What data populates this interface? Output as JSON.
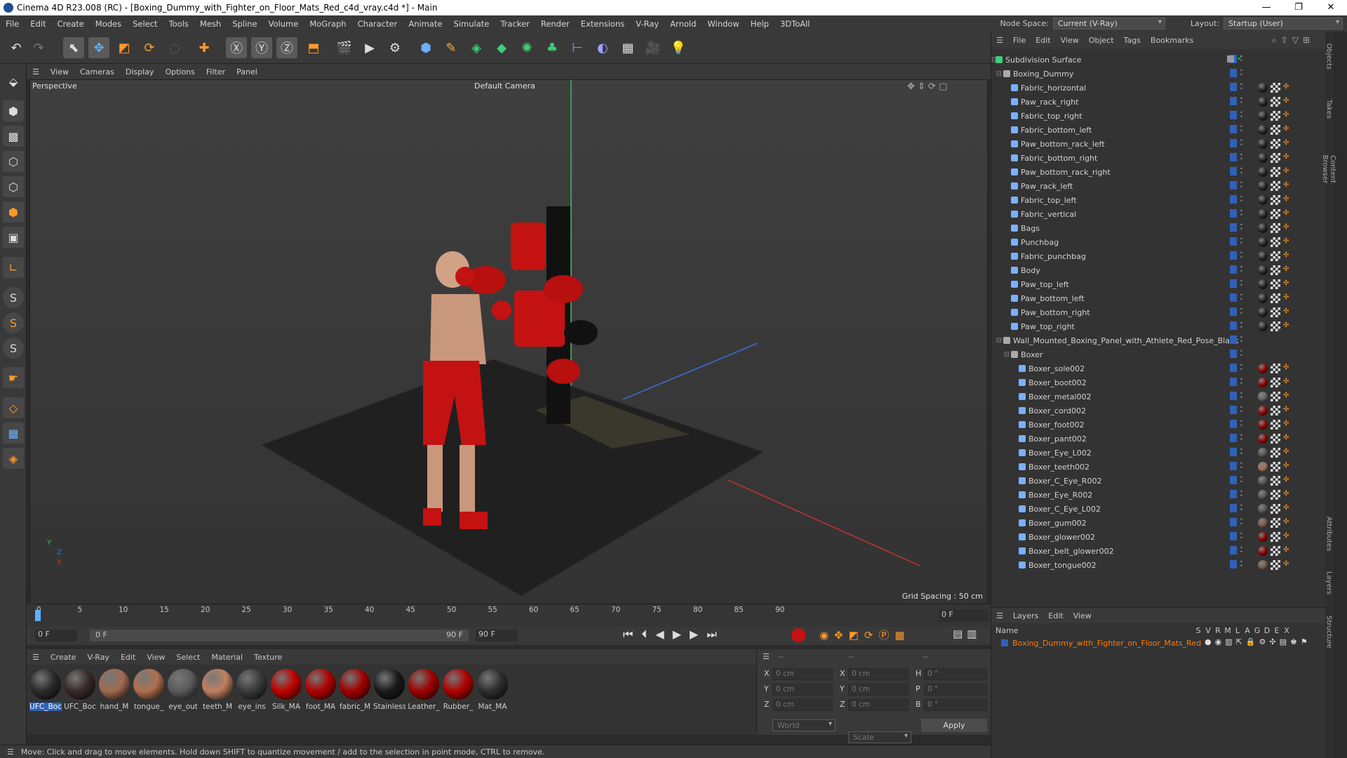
{
  "window": {
    "title": "Cinema 4D R23.008 (RC) - [Boxing_Dummy_with_Fighter_on_Floor_Mats_Red_c4d_vray.c4d *] - Main",
    "controls": [
      "—",
      "❐",
      "✕"
    ]
  },
  "menubar": {
    "items": [
      "File",
      "Edit",
      "Create",
      "Modes",
      "Select",
      "Tools",
      "Mesh",
      "Spline",
      "Volume",
      "MoGraph",
      "Character",
      "Animate",
      "Simulate",
      "Tracker",
      "Render",
      "Extensions",
      "V-Ray",
      "Arnold",
      "Window",
      "Help",
      "3DToAll"
    ],
    "node_space_label": "Node Space:",
    "node_space_value": "Current (V-Ray)",
    "layout_label": "Layout:",
    "layout_value": "Startup (User)"
  },
  "viewport": {
    "menu": [
      "View",
      "Cameras",
      "Display",
      "Options",
      "Filter",
      "Panel"
    ],
    "view_name": "Perspective",
    "camera": "Default Camera",
    "grid_spacing": "Grid Spacing : 50 cm",
    "axis_x": "X",
    "axis_y": "Y",
    "axis_z": "Z"
  },
  "timeline": {
    "ticks": [
      "0",
      "5",
      "10",
      "15",
      "20",
      "25",
      "30",
      "35",
      "40",
      "45",
      "50",
      "55",
      "60",
      "65",
      "70",
      "75",
      "80",
      "85",
      "90"
    ],
    "current_frame": "0 F",
    "start_frame": "0 F",
    "range_start": "0 F",
    "range_end": "90 F",
    "end_frame": "90 F"
  },
  "material_manager": {
    "menu": [
      "Create",
      "V-Ray",
      "Edit",
      "View",
      "Select",
      "Material",
      "Texture"
    ],
    "materials": [
      {
        "label": "UFC_Boc",
        "color": "#2a2a2a",
        "selected": true
      },
      {
        "label": "UFC_Boc",
        "color": "#3a2a2a",
        "selected": false
      },
      {
        "label": "hand_M",
        "color": "#a06a50",
        "selected": false
      },
      {
        "label": "tongue_",
        "color": "#b07050",
        "selected": false
      },
      {
        "label": "eye_out",
        "color": "#5a5a5a",
        "selected": false
      },
      {
        "label": "teeth_M",
        "color": "#c08060",
        "selected": false
      },
      {
        "label": "eye_ins",
        "color": "#3a3a3a",
        "selected": false
      },
      {
        "label": "Silk_MA",
        "color": "#c00000",
        "selected": false
      },
      {
        "label": "foot_MA",
        "color": "#b00000",
        "selected": false
      },
      {
        "label": "fabric_M",
        "color": "#a00000",
        "selected": false
      },
      {
        "label": "Stainless",
        "color": "#1a1a1a",
        "selected": false
      },
      {
        "label": "Leather_",
        "color": "#a00000",
        "selected": false
      },
      {
        "label": "Rubber_",
        "color": "#b00000",
        "selected": false
      },
      {
        "label": "Mat_MA",
        "color": "#2e2e2e",
        "selected": false
      }
    ]
  },
  "coordinates": {
    "header": [
      "--",
      "--",
      "--"
    ],
    "rows": [
      {
        "a": "X",
        "av": "0 cm",
        "b": "X",
        "bv": "0 cm",
        "c": "H",
        "cv": "0 °"
      },
      {
        "a": "Y",
        "av": "0 cm",
        "b": "Y",
        "bv": "0 cm",
        "c": "P",
        "cv": "0 °"
      },
      {
        "a": "Z",
        "av": "0 cm",
        "b": "Z",
        "bv": "0 cm",
        "c": "B",
        "cv": "0 °"
      }
    ],
    "space": "World",
    "mode": "Scale",
    "apply": "Apply"
  },
  "status": "Move: Click and drag to move elements. Hold down SHIFT to quantize movement / add to the selection in point mode, CTRL to remove.",
  "object_manager": {
    "menu": [
      "File",
      "Edit",
      "View",
      "Object",
      "Tags",
      "Bookmarks"
    ],
    "objects": [
      {
        "name": "Subdivision Surface",
        "depth": 0,
        "tag": "none"
      },
      {
        "name": "Boxing_Dummy",
        "depth": 1,
        "tag": "none"
      },
      {
        "name": "Fabric_horizontal",
        "depth": 2,
        "tag": "#222"
      },
      {
        "name": "Paw_rack_right",
        "depth": 2,
        "tag": "#222"
      },
      {
        "name": "Fabric_top_right",
        "depth": 2,
        "tag": "#222"
      },
      {
        "name": "Fabric_bottom_left",
        "depth": 2,
        "tag": "#222"
      },
      {
        "name": "Paw_bottom_rack_left",
        "depth": 2,
        "tag": "#222"
      },
      {
        "name": "Fabric_bottom_right",
        "depth": 2,
        "tag": "#222"
      },
      {
        "name": "Paw_bottom_rack_right",
        "depth": 2,
        "tag": "#222"
      },
      {
        "name": "Paw_rack_left",
        "depth": 2,
        "tag": "#222"
      },
      {
        "name": "Fabric_top_left",
        "depth": 2,
        "tag": "#222"
      },
      {
        "name": "Fabric_vertical",
        "depth": 2,
        "tag": "#222"
      },
      {
        "name": "Bags",
        "depth": 2,
        "tag": "#222"
      },
      {
        "name": "Punchbag",
        "depth": 2,
        "tag": "#222"
      },
      {
        "name": "Fabric_punchbag",
        "depth": 2,
        "tag": "#222"
      },
      {
        "name": "Body",
        "depth": 2,
        "tag": "#222"
      },
      {
        "name": "Paw_top_left",
        "depth": 2,
        "tag": "#222"
      },
      {
        "name": "Paw_bottom_left",
        "depth": 2,
        "tag": "#222"
      },
      {
        "name": "Paw_bottom_right",
        "depth": 2,
        "tag": "#222"
      },
      {
        "name": "Paw_top_right",
        "depth": 2,
        "tag": "#222"
      },
      {
        "name": "Wall_Mounted_Boxing_Panel_with_Athlete_Red_Pose_Black",
        "depth": 1,
        "tag": "none"
      },
      {
        "name": "Boxer",
        "depth": 2,
        "tag": "none"
      },
      {
        "name": "Boxer_sole002",
        "depth": 3,
        "tag": "#8a0000"
      },
      {
        "name": "Boxer_boot002",
        "depth": 3,
        "tag": "#8a0000"
      },
      {
        "name": "Boxer_metal002",
        "depth": 3,
        "tag": "#666"
      },
      {
        "name": "Boxer_cord002",
        "depth": 3,
        "tag": "#8a0000"
      },
      {
        "name": "Boxer_foot002",
        "depth": 3,
        "tag": "#8a0000"
      },
      {
        "name": "Boxer_pant002",
        "depth": 3,
        "tag": "#8a0000"
      },
      {
        "name": "Boxer_Eye_L002",
        "depth": 3,
        "tag": "#555"
      },
      {
        "name": "Boxer_teeth002",
        "depth": 3,
        "tag": "#a07050"
      },
      {
        "name": "Boxer_C_Eye_R002",
        "depth": 3,
        "tag": "#555"
      },
      {
        "name": "Boxer_Eye_R002",
        "depth": 3,
        "tag": "#555"
      },
      {
        "name": "Boxer_C_Eye_L002",
        "depth": 3,
        "tag": "#555"
      },
      {
        "name": "Boxer_gum002",
        "depth": 3,
        "tag": "#7a5a4a"
      },
      {
        "name": "Boxer_glower002",
        "depth": 3,
        "tag": "#8a0000"
      },
      {
        "name": "Boxer_belt_glower002",
        "depth": 3,
        "tag": "#8a0000"
      },
      {
        "name": "Boxer_tongue002",
        "depth": 3,
        "tag": "#7a5a4a"
      }
    ]
  },
  "layer_manager": {
    "menu": [
      "Layers",
      "Edit",
      "View"
    ],
    "name_header": "Name",
    "cols": [
      "S",
      "V",
      "R",
      "M",
      "L",
      "A",
      "G",
      "D",
      "E",
      "X"
    ],
    "layer": "Boxing_Dummy_with_Fighter_on_Floor_Mats_Red",
    "layer_color": "#ff7a00"
  },
  "side_tabs": [
    "Objects",
    "Takes",
    "Content Browser",
    "Attributes",
    "Layers",
    "Structure"
  ],
  "colors": {
    "accent": "#2f62b6",
    "selection_orange": "#ff7a00"
  }
}
